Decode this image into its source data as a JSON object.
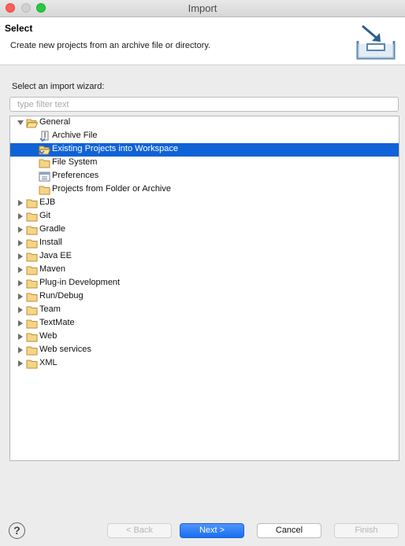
{
  "window": {
    "title": "Import"
  },
  "header": {
    "title": "Select",
    "description": "Create new projects from an archive file or directory."
  },
  "wizard": {
    "label": "Select an import wizard:",
    "filter_placeholder": "type filter text",
    "filter_value": ""
  },
  "tree": [
    {
      "label": "General",
      "depth": 0,
      "expanded": true,
      "icon": "folder-open-icon",
      "name": "tree-item-general"
    },
    {
      "label": "Archive File",
      "depth": 1,
      "icon": "archive-file-icon",
      "name": "tree-item-archive-file"
    },
    {
      "label": "Existing Projects into Workspace",
      "depth": 1,
      "icon": "existing-projects-icon",
      "selected": true,
      "name": "tree-item-existing-projects"
    },
    {
      "label": "File System",
      "depth": 1,
      "icon": "folder-icon",
      "name": "tree-item-file-system"
    },
    {
      "label": "Preferences",
      "depth": 1,
      "icon": "preferences-icon",
      "name": "tree-item-preferences"
    },
    {
      "label": "Projects from Folder or Archive",
      "depth": 1,
      "icon": "folder-icon",
      "name": "tree-item-projects-from-folder"
    },
    {
      "label": "EJB",
      "depth": 0,
      "expanded": false,
      "icon": "folder-icon",
      "name": "tree-item-ejb"
    },
    {
      "label": "Git",
      "depth": 0,
      "expanded": false,
      "icon": "folder-icon",
      "name": "tree-item-git"
    },
    {
      "label": "Gradle",
      "depth": 0,
      "expanded": false,
      "icon": "folder-icon",
      "name": "tree-item-gradle"
    },
    {
      "label": "Install",
      "depth": 0,
      "expanded": false,
      "icon": "folder-icon",
      "name": "tree-item-install"
    },
    {
      "label": "Java EE",
      "depth": 0,
      "expanded": false,
      "icon": "folder-icon",
      "name": "tree-item-java-ee"
    },
    {
      "label": "Maven",
      "depth": 0,
      "expanded": false,
      "icon": "folder-icon",
      "name": "tree-item-maven"
    },
    {
      "label": "Plug-in Development",
      "depth": 0,
      "expanded": false,
      "icon": "folder-icon",
      "name": "tree-item-plug-in-development"
    },
    {
      "label": "Run/Debug",
      "depth": 0,
      "expanded": false,
      "icon": "folder-icon",
      "name": "tree-item-run-debug"
    },
    {
      "label": "Team",
      "depth": 0,
      "expanded": false,
      "icon": "folder-icon",
      "name": "tree-item-team"
    },
    {
      "label": "TextMate",
      "depth": 0,
      "expanded": false,
      "icon": "folder-icon",
      "name": "tree-item-textmate"
    },
    {
      "label": "Web",
      "depth": 0,
      "expanded": false,
      "icon": "folder-icon",
      "name": "tree-item-web"
    },
    {
      "label": "Web services",
      "depth": 0,
      "expanded": false,
      "icon": "folder-icon",
      "name": "tree-item-web-services"
    },
    {
      "label": "XML",
      "depth": 0,
      "expanded": false,
      "icon": "folder-icon",
      "name": "tree-item-xml"
    }
  ],
  "buttons": {
    "help": "?",
    "back": "< Back",
    "next": "Next >",
    "cancel": "Cancel",
    "finish": "Finish"
  },
  "colors": {
    "selection": "#0f63d6",
    "folder_fill": "#f3d58a",
    "folder_stroke": "#c08e2d",
    "next_button": "#1a6ff0"
  }
}
